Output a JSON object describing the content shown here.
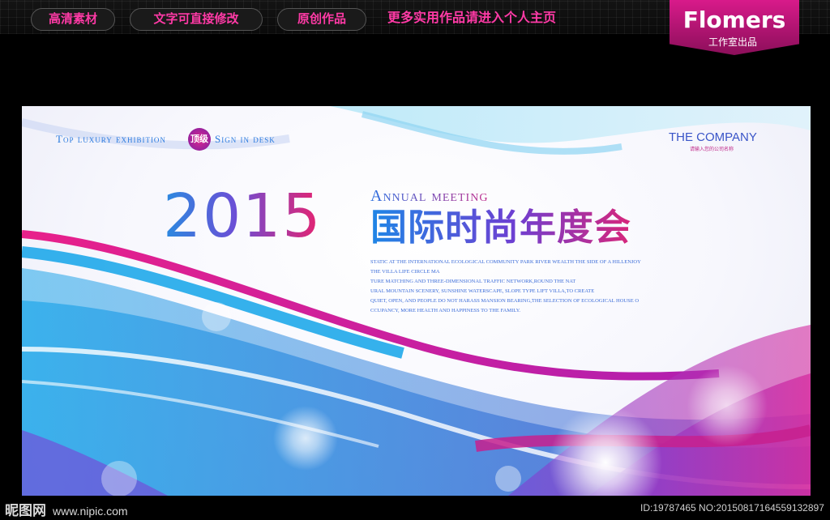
{
  "topbar": {
    "tags": [
      "高清素材",
      "文字可直接修改",
      "原创作品"
    ],
    "more_link": "更多实用作品请进入个人主页"
  },
  "brand": {
    "name": "Flomers",
    "sub": "工作室出品"
  },
  "poster": {
    "top_left": "Top luxury exhibition",
    "badge": "顶级",
    "top_left_2": "Sign in desk",
    "company": "THE COMPANY",
    "company_sub": "请输入您的公司名称",
    "year": "2015",
    "annual": "Annual meeting",
    "title_cn": "国际时尚年度会",
    "description": [
      "STATIC AT THE INTERNATIONAL ECOLOGICAL COMMUNITY PARK RIVER WEALTH THE SIDE OF A HILLENJOY",
      "THE VILLA LIFE CIRCLE MA",
      "TURE MATCHING AND THREE-DIMENSIONAL TRAFFIC NETWORK,ROUND THE NAT",
      "URAL MOUNTAIN SCENERY, SUNSHINE WATERSCAPE, SLOPE TYPE LIFT VILLA,TO CREATE",
      "QUIET, OPEN, AND PEOPLE DO NOT HARASS MANSION BEARING,THE SELECTION OF ECOLOGICAL HOUSE O",
      "CCUPANCY, MORE HEALTH AND HAPPINESS TO THE FAMILY."
    ]
  },
  "watermark": {
    "site_name": "昵图网",
    "site_url": "www.nipic.com",
    "id_text": "ID:19787465 NO:20150817164559132897"
  },
  "colors": {
    "accent_pink": "#ff3aa6",
    "brand_magenta": "#d81a8a",
    "blue": "#2b7bdf",
    "purple": "#6a4fd6"
  }
}
